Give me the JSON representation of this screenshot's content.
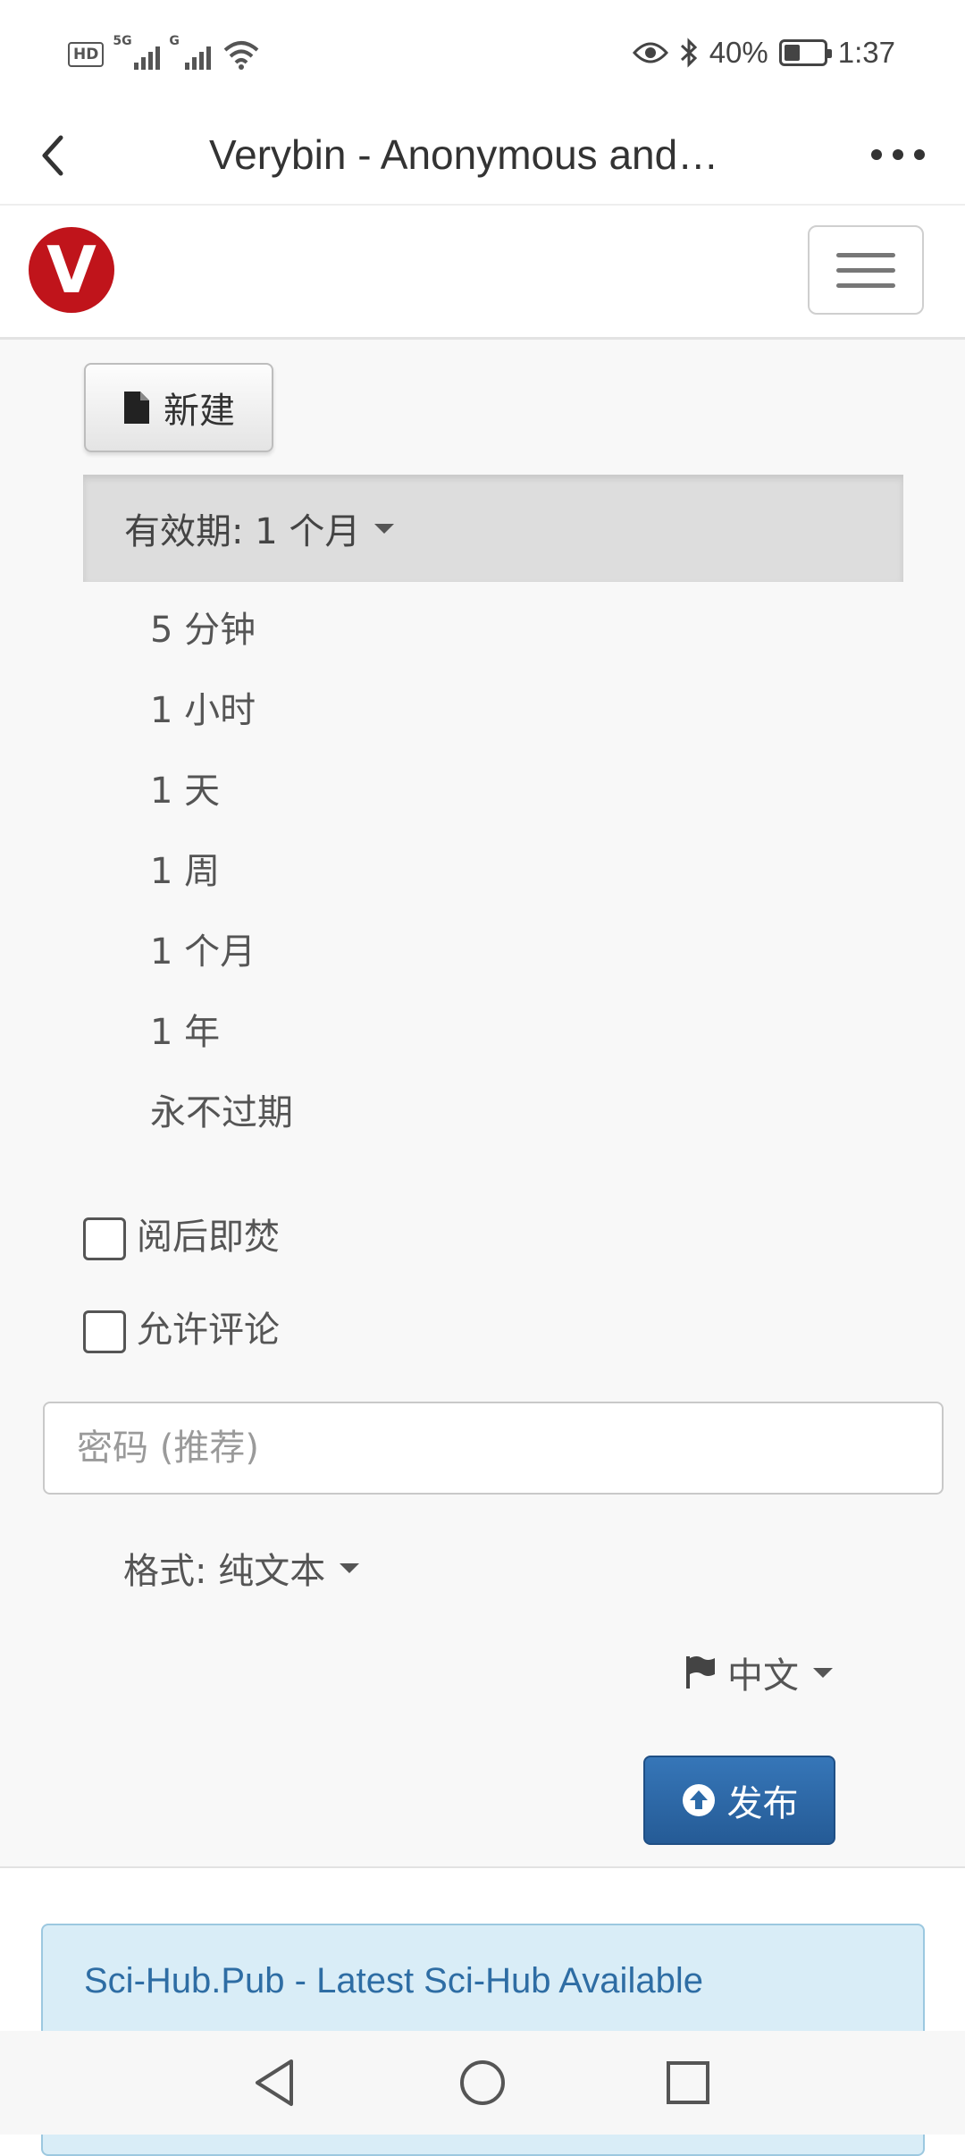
{
  "status_bar": {
    "hd_label": "HD",
    "sim1_label": "5G",
    "sim2_label": "G",
    "battery_percent": "40%",
    "battery_level": 0.4,
    "time": "1:37"
  },
  "app_bar": {
    "title": "Verybin - Anonymous and…",
    "back_icon": "chevron-left-icon",
    "more_icon": "more-horizontal-icon"
  },
  "site_nav": {
    "logo_letter": "V",
    "logo_color": "#c0141b",
    "menu_icon": "hamburger-icon"
  },
  "form": {
    "new_button_label": "新建",
    "expiry_label": "有效期: 1 个月",
    "expiry_options": [
      "5 分钟",
      "1 小时",
      "1 天",
      "1 周",
      "1 个月",
      "1 年",
      "永不过期"
    ],
    "burn_after_reading_label": "阅后即焚",
    "allow_comments_label": "允许评论",
    "password_placeholder": "密码 (推荐)",
    "format_label": "格式: 纯文本",
    "language_label": "中文",
    "publish_label": "发布",
    "accent_color": "#2c6aa8"
  },
  "ad": {
    "link_text": "Sci-Hub.Pub - Latest Sci-Hub Available"
  },
  "nav_bar": {
    "back_icon": "triangle-back-icon",
    "home_icon": "circle-home-icon",
    "recents_icon": "square-recents-icon"
  }
}
